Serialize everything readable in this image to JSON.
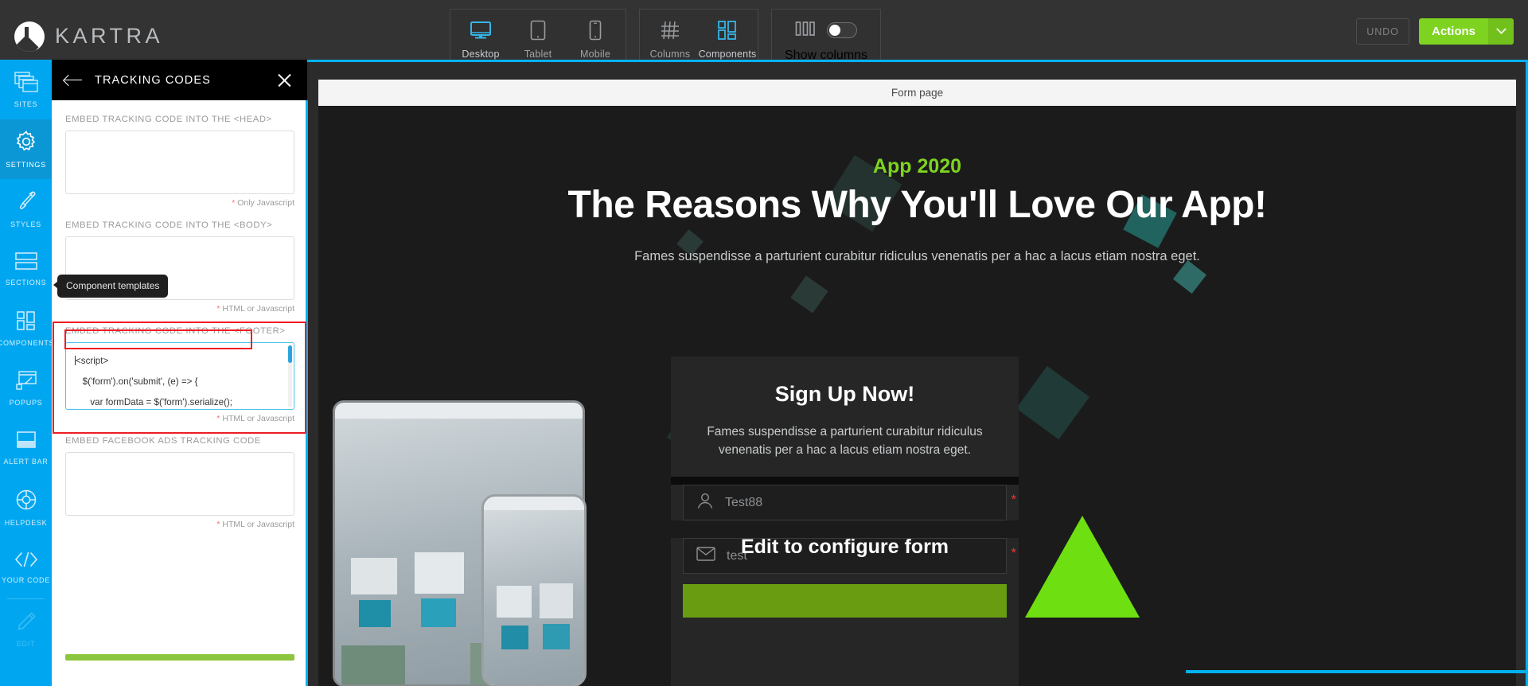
{
  "app": {
    "brand": "KARTRA"
  },
  "toolbar": {
    "devices": [
      {
        "label": "Desktop",
        "icon": "desktop-icon",
        "active": true
      },
      {
        "label": "Tablet",
        "icon": "tablet-icon",
        "active": false
      },
      {
        "label": "Mobile",
        "icon": "mobile-icon",
        "active": false
      }
    ],
    "layout": [
      {
        "label": "Columns",
        "icon": "columns-grid-icon",
        "active": false
      },
      {
        "label": "Components",
        "icon": "components-icon",
        "active": true
      }
    ],
    "show_columns": {
      "label": "Show columns",
      "icon": "columns-bars-icon",
      "toggle_state": "off"
    },
    "undo_label": "UNDO",
    "actions_label": "Actions",
    "actions_caret_icon": "chevron-down-icon"
  },
  "sidebar": {
    "items": [
      {
        "label": "SITES",
        "icon": "sites-windows-icon",
        "active": false
      },
      {
        "label": "SETTINGS",
        "icon": "gear-icon",
        "active": true
      },
      {
        "label": "STYLES",
        "icon": "paintbrush-icon",
        "active": false
      },
      {
        "label": "SECTIONS",
        "icon": "sections-stack-icon",
        "active": false
      },
      {
        "label": "COMPONENTS",
        "icon": "components-icon",
        "active": false
      },
      {
        "label": "POPUPS",
        "icon": "popup-window-icon",
        "active": false
      },
      {
        "label": "ALERT BAR",
        "icon": "alert-bar-icon",
        "active": false
      },
      {
        "label": "HELPDESK",
        "icon": "lifebuoy-icon",
        "active": false
      },
      {
        "label": "YOUR CODE",
        "icon": "code-brackets-icon",
        "active": false
      },
      {
        "label": "EDIT",
        "icon": "pencil-icon",
        "active": false,
        "dim": true
      }
    ]
  },
  "panel": {
    "title": "TRACKING CODES",
    "back_icon": "arrow-left-icon",
    "close_icon": "close-icon",
    "fields": [
      {
        "label": "EMBED TRACKING CODE INTO THE <HEAD>",
        "value": "",
        "hint_star": "*",
        "hint": " Only Javascript"
      },
      {
        "label": "EMBED TRACKING CODE INTO THE <BODY>",
        "value": "",
        "hint_star": "*",
        "hint": " HTML or Javascript"
      },
      {
        "label": "EMBED TRACKING CODE INTO THE <FOOTER>",
        "value": "",
        "hint_star": "*",
        "hint": " HTML or Javascript",
        "highlighted": true,
        "focused": true,
        "code_lines": [
          "<script>",
          "   $('form').on('submit', (e) => {",
          "",
          "      var formData = $('form').serialize();"
        ]
      },
      {
        "label": "EMBED FACEBOOK ADS TRACKING CODE",
        "value": "",
        "hint_star": "*",
        "hint": " HTML or Javascript"
      }
    ],
    "tooltip": "Component templates"
  },
  "canvas": {
    "page_tab_label": "Form page",
    "hero": {
      "eyebrow": "App 2020",
      "title": "The Reasons Why You'll Love Our App!",
      "subtitle": "Fames suspendisse a parturient curabitur ridiculus venenatis per a hac a lacus etiam nostra eget."
    },
    "form": {
      "title": "Sign Up Now!",
      "subtitle": "Fames suspendisse a parturient curabitur ridiculus venenatis per a hac a lacus etiam nostra eget.",
      "fields": [
        {
          "icon": "user-icon",
          "value": "Test88",
          "required_marker": "*"
        },
        {
          "icon": "envelope-icon",
          "value": "test",
          "required_marker": "*"
        }
      ],
      "overlay_message": "Edit to configure form"
    }
  },
  "colors": {
    "brand_blue": "#00a7f0",
    "accent_green": "#7ed321",
    "highlight_red": "#ee1d23",
    "focus_cyan": "#4ec3e8",
    "topbar_dark": "#333333"
  }
}
